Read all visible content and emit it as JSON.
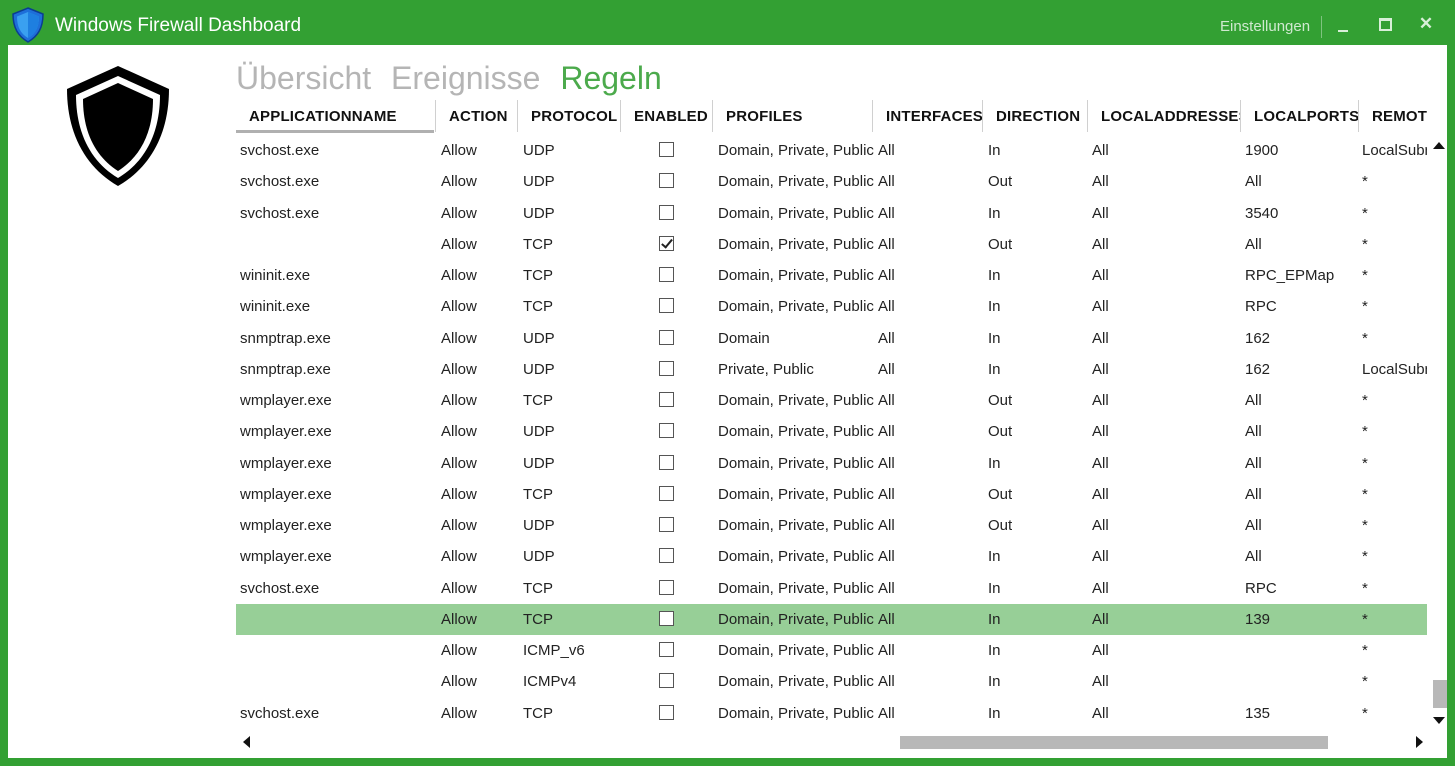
{
  "window": {
    "title": "Windows Firewall Dashboard",
    "settings_label": "Einstellungen",
    "close_glyph": "✕"
  },
  "colors": {
    "titlebar": "#33a033",
    "accent": "#4caa4c",
    "selected_row": "#97cf97",
    "inactive_nav": "#b5b5b5"
  },
  "icons": {
    "app": "shield-icon",
    "logo": "shield-logo-icon"
  },
  "nav": {
    "tabs": [
      {
        "label": "Übersicht"
      },
      {
        "label": "Ereignisse"
      },
      {
        "label": "Regeln"
      }
    ],
    "active": "Regeln"
  },
  "table": {
    "columns": [
      "APPLICATIONNAME",
      "ACTION",
      "PROTOCOL",
      "ENABLED",
      "PROFILES",
      "INTERFACES",
      "DIRECTION",
      "LOCALADDRESSES",
      "LOCALPORTS",
      "REMOTEA"
    ],
    "selected_index": 15,
    "rows": [
      {
        "app": "svchost.exe",
        "action": "Allow",
        "protocol": "UDP",
        "enabled": false,
        "profiles": "Domain, Private, Public",
        "interfaces": "All",
        "direction": "In",
        "localaddresses": "All",
        "localports": "1900",
        "remote": "LocalSubn"
      },
      {
        "app": "svchost.exe",
        "action": "Allow",
        "protocol": "UDP",
        "enabled": false,
        "profiles": "Domain, Private, Public",
        "interfaces": "All",
        "direction": "Out",
        "localaddresses": "All",
        "localports": "All",
        "remote": "*"
      },
      {
        "app": "svchost.exe",
        "action": "Allow",
        "protocol": "UDP",
        "enabled": false,
        "profiles": "Domain, Private, Public",
        "interfaces": "All",
        "direction": "In",
        "localaddresses": "All",
        "localports": "3540",
        "remote": "*"
      },
      {
        "app": "",
        "action": "Allow",
        "protocol": "TCP",
        "enabled": true,
        "profiles": "Domain, Private, Public",
        "interfaces": "All",
        "direction": "Out",
        "localaddresses": "All",
        "localports": "All",
        "remote": "*"
      },
      {
        "app": "wininit.exe",
        "action": "Allow",
        "protocol": "TCP",
        "enabled": false,
        "profiles": "Domain, Private, Public",
        "interfaces": "All",
        "direction": "In",
        "localaddresses": "All",
        "localports": "RPC_EPMap",
        "remote": "*"
      },
      {
        "app": "wininit.exe",
        "action": "Allow",
        "protocol": "TCP",
        "enabled": false,
        "profiles": "Domain, Private, Public",
        "interfaces": "All",
        "direction": "In",
        "localaddresses": "All",
        "localports": "RPC",
        "remote": "*"
      },
      {
        "app": "snmptrap.exe",
        "action": "Allow",
        "protocol": "UDP",
        "enabled": false,
        "profiles": "Domain",
        "interfaces": "All",
        "direction": "In",
        "localaddresses": "All",
        "localports": "162",
        "remote": "*"
      },
      {
        "app": "snmptrap.exe",
        "action": "Allow",
        "protocol": "UDP",
        "enabled": false,
        "profiles": "Private, Public",
        "interfaces": "All",
        "direction": "In",
        "localaddresses": "All",
        "localports": "162",
        "remote": "LocalSubn"
      },
      {
        "app": "wmplayer.exe",
        "action": "Allow",
        "protocol": "TCP",
        "enabled": false,
        "profiles": "Domain, Private, Public",
        "interfaces": "All",
        "direction": "Out",
        "localaddresses": "All",
        "localports": "All",
        "remote": "*"
      },
      {
        "app": "wmplayer.exe",
        "action": "Allow",
        "protocol": "UDP",
        "enabled": false,
        "profiles": "Domain, Private, Public",
        "interfaces": "All",
        "direction": "Out",
        "localaddresses": "All",
        "localports": "All",
        "remote": "*"
      },
      {
        "app": "wmplayer.exe",
        "action": "Allow",
        "protocol": "UDP",
        "enabled": false,
        "profiles": "Domain, Private, Public",
        "interfaces": "All",
        "direction": "In",
        "localaddresses": "All",
        "localports": "All",
        "remote": "*"
      },
      {
        "app": "wmplayer.exe",
        "action": "Allow",
        "protocol": "TCP",
        "enabled": false,
        "profiles": "Domain, Private, Public",
        "interfaces": "All",
        "direction": "Out",
        "localaddresses": "All",
        "localports": "All",
        "remote": "*"
      },
      {
        "app": "wmplayer.exe",
        "action": "Allow",
        "protocol": "UDP",
        "enabled": false,
        "profiles": "Domain, Private, Public",
        "interfaces": "All",
        "direction": "Out",
        "localaddresses": "All",
        "localports": "All",
        "remote": "*"
      },
      {
        "app": "wmplayer.exe",
        "action": "Allow",
        "protocol": "UDP",
        "enabled": false,
        "profiles": "Domain, Private, Public",
        "interfaces": "All",
        "direction": "In",
        "localaddresses": "All",
        "localports": "All",
        "remote": "*"
      },
      {
        "app": "svchost.exe",
        "action": "Allow",
        "protocol": "TCP",
        "enabled": false,
        "profiles": "Domain, Private, Public",
        "interfaces": "All",
        "direction": "In",
        "localaddresses": "All",
        "localports": "RPC",
        "remote": "*"
      },
      {
        "app": "",
        "action": "Allow",
        "protocol": "TCP",
        "enabled": false,
        "profiles": "Domain, Private, Public",
        "interfaces": "All",
        "direction": "In",
        "localaddresses": "All",
        "localports": "139",
        "remote": "*"
      },
      {
        "app": "",
        "action": "Allow",
        "protocol": "ICMP_v6",
        "enabled": false,
        "profiles": "Domain, Private, Public",
        "interfaces": "All",
        "direction": "In",
        "localaddresses": "All",
        "localports": "",
        "remote": "*"
      },
      {
        "app": "",
        "action": "Allow",
        "protocol": "ICMPv4",
        "enabled": false,
        "profiles": "Domain, Private, Public",
        "interfaces": "All",
        "direction": "In",
        "localaddresses": "All",
        "localports": "",
        "remote": "*"
      },
      {
        "app": "svchost.exe",
        "action": "Allow",
        "protocol": "TCP",
        "enabled": false,
        "profiles": "Domain, Private, Public",
        "interfaces": "All",
        "direction": "In",
        "localaddresses": "All",
        "localports": "135",
        "remote": "*"
      }
    ]
  }
}
